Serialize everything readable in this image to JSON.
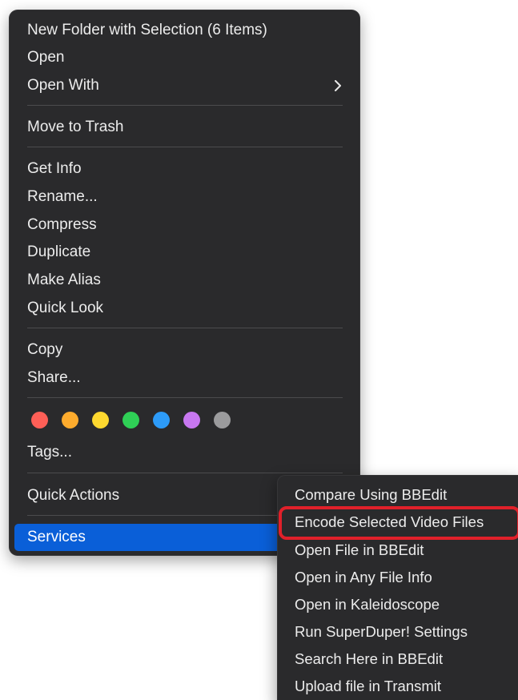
{
  "menu": {
    "items": [
      {
        "label": "New Folder with Selection (6 Items)"
      },
      {
        "label": "Open"
      },
      {
        "label": "Open With"
      },
      {
        "label": "Move to Trash"
      },
      {
        "label": "Get Info"
      },
      {
        "label": "Rename..."
      },
      {
        "label": "Compress"
      },
      {
        "label": "Duplicate"
      },
      {
        "label": "Make Alias"
      },
      {
        "label": "Quick Look"
      },
      {
        "label": "Copy"
      },
      {
        "label": "Share..."
      },
      {
        "label": "Tags..."
      },
      {
        "label": "Quick Actions"
      },
      {
        "label": "Services"
      }
    ],
    "tag_colors": [
      {
        "name": "red",
        "color": "#fe5f57"
      },
      {
        "name": "orange",
        "color": "#fdab2d"
      },
      {
        "name": "yellow",
        "color": "#fed82f"
      },
      {
        "name": "green",
        "color": "#2fcf56"
      },
      {
        "name": "blue",
        "color": "#2d9bf8"
      },
      {
        "name": "purple",
        "color": "#c777f0"
      },
      {
        "name": "gray",
        "color": "#9b9b9d"
      }
    ],
    "selected_item": "Services",
    "selected_color": "#0a5fd8"
  },
  "services_submenu": {
    "items": [
      {
        "label": "Compare Using BBEdit"
      },
      {
        "label": "Encode Selected Video Files"
      },
      {
        "label": "Open File in BBEdit"
      },
      {
        "label": "Open in Any File Info"
      },
      {
        "label": "Open in Kaleidoscope"
      },
      {
        "label": "Run SuperDuper! Settings"
      },
      {
        "label": "Search Here in BBEdit"
      },
      {
        "label": "Upload file in Transmit"
      }
    ],
    "highlighted_item": "Encode Selected Video Files",
    "highlight_color": "#e0202a"
  }
}
